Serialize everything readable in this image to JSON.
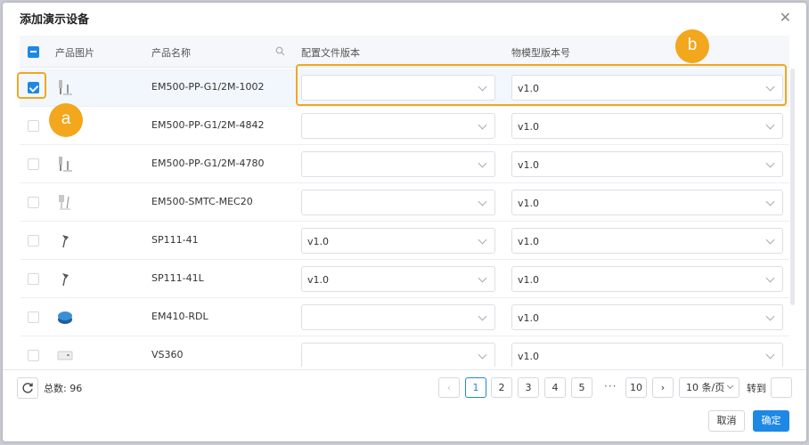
{
  "dialog": {
    "title": "添加演示设备",
    "close_icon": "close-icon"
  },
  "table": {
    "columns": {
      "image": "产品图片",
      "name": "产品名称",
      "config": "配置文件版本",
      "model": "物模型版本号"
    },
    "rows": [
      {
        "name": "EM500-PP-G1/2M-1002",
        "config": "",
        "model": "v1.0",
        "checked": true,
        "icon": "pressure-sensor-icon"
      },
      {
        "name": "EM500-PP-G1/2M-4842",
        "config": "",
        "model": "v1.0",
        "checked": false,
        "icon": "pressure-sensor-icon"
      },
      {
        "name": "EM500-PP-G1/2M-4780",
        "config": "",
        "model": "v1.0",
        "checked": false,
        "icon": "pressure-sensor-icon"
      },
      {
        "name": "EM500-SMTC-MEC20",
        "config": "",
        "model": "v1.0",
        "checked": false,
        "icon": "soil-sensor-icon"
      },
      {
        "name": "SP111-41",
        "config": "v1.0",
        "model": "v1.0",
        "checked": false,
        "icon": "spike-sensor-icon"
      },
      {
        "name": "SP111-41L",
        "config": "v1.0",
        "model": "v1.0",
        "checked": false,
        "icon": "spike-sensor-icon"
      },
      {
        "name": "EM410-RDL",
        "config": "",
        "model": "v1.0",
        "checked": false,
        "icon": "radar-sensor-icon"
      },
      {
        "name": "VS360",
        "config": "",
        "model": "v1.0",
        "checked": false,
        "icon": "people-counter-icon"
      }
    ]
  },
  "footer": {
    "total_label": "总数:",
    "total_value": "96",
    "pages": [
      "1",
      "2",
      "3",
      "4",
      "5"
    ],
    "ellipsis": "···",
    "last_page": "10",
    "page_size": "10 条/页",
    "goto_label": "转到",
    "current_page": 1
  },
  "actions": {
    "cancel": "取消",
    "ok": "确定"
  },
  "callouts": {
    "a": "a",
    "b": "b"
  },
  "colors": {
    "primary": "#1e88e5",
    "callout": "#f2a71c"
  }
}
